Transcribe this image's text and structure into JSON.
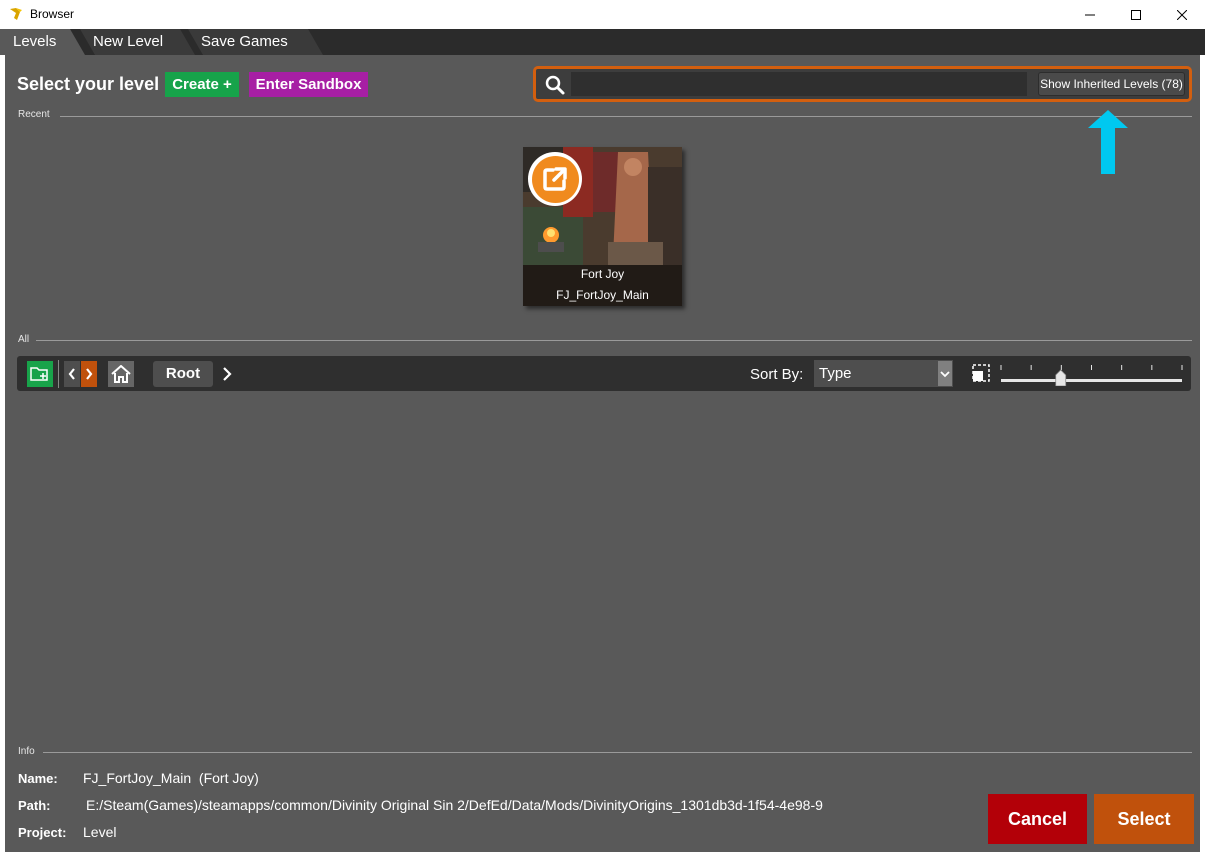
{
  "window": {
    "title": "Browser"
  },
  "tabs": [
    {
      "label": "Levels"
    },
    {
      "label": "New Level"
    },
    {
      "label": "Save Games"
    }
  ],
  "header": {
    "title": "Select your level",
    "create_label": "Create +",
    "sandbox_label": "Enter Sandbox"
  },
  "search": {
    "value": "",
    "inherited_label": "Show Inherited Levels (78)"
  },
  "sections": {
    "recent": "Recent",
    "all": "All",
    "info": "Info"
  },
  "recent_levels": [
    {
      "name": "Fort Joy",
      "id": "FJ_FortJoy_Main"
    }
  ],
  "toolbar": {
    "root_label": "Root",
    "sort_label": "Sort By:",
    "sort_value": "Type",
    "zoom_level": 0.33
  },
  "info": {
    "name_key": "Name:",
    "name_value": "FJ_FortJoy_Main  (Fort Joy)",
    "path_key": "Path:",
    "path_value": "E:/Steam(Games)/steamapps/common/Divinity Original Sin 2/DefEd/Data/Mods/DivinityOrigins_1301db3d-1f54-4e98-9",
    "project_key": "Project:",
    "project_value": "Level"
  },
  "actions": {
    "cancel_label": "Cancel",
    "select_label": "Select"
  },
  "colors": {
    "create": "#16a34a",
    "sandbox": "#a71fa4",
    "search_border": "#d35f0f",
    "cancel": "#b30008",
    "select": "#c0510c",
    "annotation_arrow": "#00c8f0"
  }
}
